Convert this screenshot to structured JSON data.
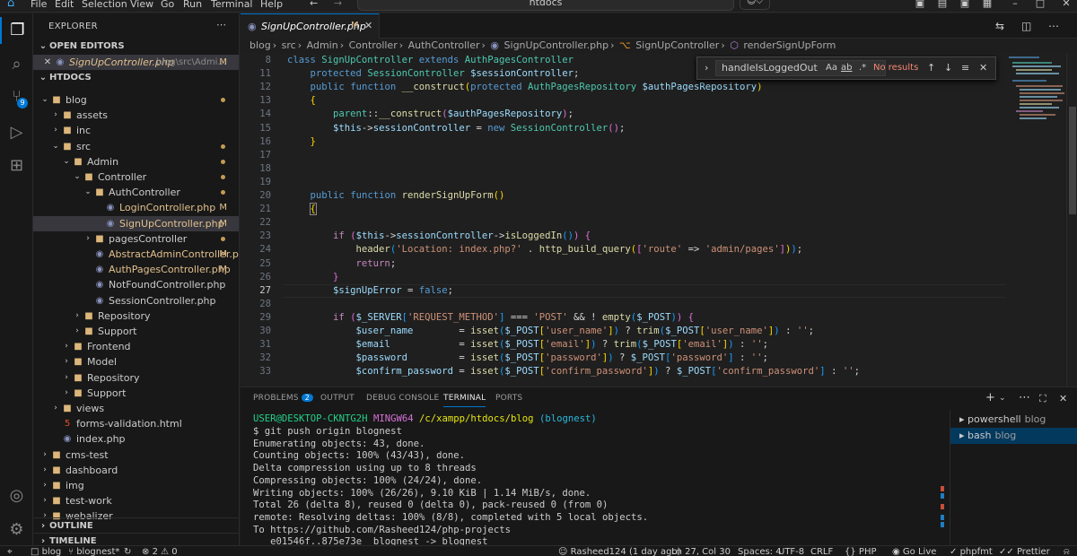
{
  "titlebar": {
    "menu": [
      "File",
      "Edit",
      "Selection",
      "View",
      "Go",
      "Run",
      "Terminal",
      "Help"
    ],
    "search_text": "htdocs"
  },
  "sidebar": {
    "title": "EXPLORER",
    "open_editors_label": "OPEN EDITORS",
    "open_editor": {
      "name": "SignUpController.php",
      "path": "blog\\src\\Admi...",
      "status": "M"
    },
    "root_label": "HTDOCS",
    "tree": [
      {
        "label": "blog",
        "depth": 1,
        "type": "folder",
        "open": true,
        "dot": true
      },
      {
        "label": "assets",
        "depth": 2,
        "type": "folder",
        "open": false
      },
      {
        "label": "inc",
        "depth": 2,
        "type": "folder",
        "open": false
      },
      {
        "label": "src",
        "depth": 2,
        "type": "folder",
        "open": true,
        "dot": true
      },
      {
        "label": "Admin",
        "depth": 3,
        "type": "folder",
        "open": true,
        "dot": true
      },
      {
        "label": "Controller",
        "depth": 4,
        "type": "folder",
        "open": true,
        "dot": true
      },
      {
        "label": "AuthController",
        "depth": 5,
        "type": "folder",
        "open": true,
        "dot": true
      },
      {
        "label": "LoginController.php",
        "depth": 6,
        "type": "php",
        "status": "M"
      },
      {
        "label": "SignUpController.php",
        "depth": 6,
        "type": "php",
        "status": "M",
        "selected": true
      },
      {
        "label": "pagesController",
        "depth": 5,
        "type": "folder",
        "open": false,
        "dot": true
      },
      {
        "label": "AbstractAdminController.php",
        "depth": 5,
        "type": "php",
        "status": "M"
      },
      {
        "label": "AuthPagesController.php",
        "depth": 5,
        "type": "php",
        "status": "M"
      },
      {
        "label": "NotFoundController.php",
        "depth": 5,
        "type": "php"
      },
      {
        "label": "SessionController.php",
        "depth": 5,
        "type": "php"
      },
      {
        "label": "Repository",
        "depth": 4,
        "type": "folder",
        "open": false
      },
      {
        "label": "Support",
        "depth": 4,
        "type": "folder",
        "open": false
      },
      {
        "label": "Frontend",
        "depth": 3,
        "type": "folder",
        "open": false
      },
      {
        "label": "Model",
        "depth": 3,
        "type": "folder",
        "open": false
      },
      {
        "label": "Repository",
        "depth": 3,
        "type": "folder",
        "open": false
      },
      {
        "label": "Support",
        "depth": 3,
        "type": "folder",
        "open": false
      },
      {
        "label": "views",
        "depth": 2,
        "type": "folder",
        "open": false
      },
      {
        "label": "forms-validation.html",
        "depth": 2,
        "type": "html"
      },
      {
        "label": "index.php",
        "depth": 2,
        "type": "php"
      },
      {
        "label": "cms-test",
        "depth": 1,
        "type": "folder",
        "open": false
      },
      {
        "label": "dashboard",
        "depth": 1,
        "type": "folder",
        "open": false
      },
      {
        "label": "img",
        "depth": 1,
        "type": "folder",
        "open": false
      },
      {
        "label": "test-work",
        "depth": 1,
        "type": "folder",
        "open": false
      },
      {
        "label": "webalizer",
        "depth": 1,
        "type": "folder",
        "open": false
      }
    ],
    "outline_label": "OUTLINE",
    "timeline_label": "TIMELINE"
  },
  "editor": {
    "tab": {
      "label": "SignUpController.php",
      "status": "M"
    },
    "breadcrumb": [
      "blog",
      "src",
      "Admin",
      "Controller",
      "AuthController",
      "SignUpController.php",
      "SignUpController",
      "renderSignUpForm"
    ],
    "find": {
      "query": "handleIsLoggedOut",
      "result": "No results"
    },
    "lines": [
      {
        "n": "8",
        "html": "<span class='kw'>class</span> <span class='cls'>SignUpController</span> <span class='kw'>extends</span> <span class='cls'>AuthPagesController</span>"
      },
      {
        "n": "11",
        "html": "    <span class='kw'>protected</span> <span class='cls'>SessionController</span> <span class='var'>$sessionController</span>;"
      },
      {
        "n": "12",
        "html": "    <span class='kw'>public</span> <span class='kw'>function</span> <span class='fn'>__construct</span><span class='br1'>(</span><span class='kw'>protected</span> <span class='cls'>AuthPagesRepository</span> <span class='var'>$authPagesRepository</span><span class='br1'>)</span>"
      },
      {
        "n": "13",
        "html": "    <span class='br1'>{</span>"
      },
      {
        "n": "14",
        "html": "        <span class='cls'>parent</span>::<span class='fn'>__construct</span><span class='br2'>(</span><span class='var'>$authPagesRepository</span><span class='br2'>)</span>;"
      },
      {
        "n": "15",
        "html": "        <span class='var'>$this</span>-&gt;<span class='var'>sessionController</span> = <span class='kw'>new</span> <span class='cls'>SessionController</span><span class='br2'>()</span>;"
      },
      {
        "n": "16",
        "html": "    <span class='br1'>}</span>"
      },
      {
        "n": "17",
        "html": ""
      },
      {
        "n": "18",
        "html": ""
      },
      {
        "n": "19",
        "html": ""
      },
      {
        "n": "20",
        "html": "    <span class='kw'>public</span> <span class='kw'>function</span> <span class='fn'>renderSignUpForm</span><span class='br1'>()</span>"
      },
      {
        "n": "21",
        "html": "    <span class='br1' style='outline:1px solid #888'>{</span>"
      },
      {
        "n": "22",
        "html": ""
      },
      {
        "n": "23",
        "html": "        <span class='kw2'>if</span> <span class='br2'>(</span><span class='var'>$this</span>-&gt;<span class='var'>sessionController</span>-&gt;<span class='fn'>isLoggedIn</span><span class='br3'>()</span><span class='br2'>)</span> <span class='br2'>{</span>"
      },
      {
        "n": "24",
        "html": "            <span class='fn'>header</span><span class='br3'>(</span><span class='str'>'Location: index.php?'</span> . <span class='fn'>http_build_query</span><span class='br1'>(</span><span class='br2'>[</span><span class='str'>'route'</span> =&gt; <span class='str'>'admin/pages'</span><span class='br2'>]</span><span class='br1'>)</span><span class='br3'>)</span>;"
      },
      {
        "n": "25",
        "html": "            <span class='kw2'>return</span>;"
      },
      {
        "n": "26",
        "html": "        <span class='br2'>}</span>"
      },
      {
        "n": "27",
        "html": "        <span class='var'>$signUpError</span> = <span class='kw'>false</span>;"
      },
      {
        "n": "28",
        "html": ""
      },
      {
        "n": "29",
        "html": "        <span class='kw2'>if</span> <span class='br2'>(</span><span class='var'>$_SERVER</span><span class='br3'>[</span><span class='str'>'REQUEST_METHOD'</span><span class='br3'>]</span> === <span class='str'>'POST'</span> &amp;&amp; ! <span class='fn'>empty</span><span class='br3'>(</span><span class='var'>$_POST</span><span class='br3'>)</span><span class='br2'>)</span> <span class='br2'>{</span>"
      },
      {
        "n": "30",
        "html": "            <span class='var'>$user_name</span>        = <span class='fn'>isset</span><span class='br3'>(</span><span class='var'>$_POST</span><span class='br1'>[</span><span class='str'>'user_name'</span><span class='br1'>]</span><span class='br3'>)</span> ? <span class='fn'>trim</span><span class='br3'>(</span><span class='var'>$_POST</span><span class='br1'>[</span><span class='str'>'user_name'</span><span class='br1'>]</span><span class='br3'>)</span> : <span class='str'>''</span>;"
      },
      {
        "n": "31",
        "html": "            <span class='var'>$email</span>            = <span class='fn'>isset</span><span class='br3'>(</span><span class='var'>$_POST</span><span class='br1'>[</span><span class='str'>'email'</span><span class='br1'>]</span><span class='br3'>)</span> ? <span class='fn'>trim</span><span class='br3'>(</span><span class='var'>$_POST</span><span class='br1'>[</span><span class='str'>'email'</span><span class='br1'>]</span><span class='br3'>)</span> : <span class='str'>''</span>;"
      },
      {
        "n": "32",
        "html": "            <span class='var'>$password</span>         = <span class='fn'>isset</span><span class='br3'>(</span><span class='var'>$_POST</span><span class='br1'>[</span><span class='str'>'password'</span><span class='br1'>]</span><span class='br3'>)</span> ? <span class='var'>$_POST</span><span class='br3'>[</span><span class='str'>'password'</span><span class='br3'>]</span> : <span class='str'>''</span>;"
      },
      {
        "n": "33",
        "html": "            <span class='var'>$confirm_password</span> = <span class='fn'>isset</span><span class='br3'>(</span><span class='var'>$_POST</span><span class='br1'>[</span><span class='str'>'confirm_password'</span><span class='br1'>]</span><span class='br3'>)</span> ? <span class='var'>$_POST</span><span class='br3'>[</span><span class='str'>'confirm_password'</span><span class='br3'>]</span> : <span class='str'>''</span>;"
      }
    ],
    "current_line": "27"
  },
  "panel": {
    "tabs": [
      "PROBLEMS",
      "OUTPUT",
      "DEBUG CONSOLE",
      "TERMINAL",
      "PORTS"
    ],
    "problems_count": "2",
    "active_tab": "TERMINAL",
    "terminal": {
      "prompt_user": "USER@DESKTOP-CKNTG2H",
      "prompt_shell": "MINGW64",
      "prompt_path": "/c/xampp/htdocs/blog",
      "prompt_branch": "(blognest)",
      "lines": [
        "$ git push origin blognest",
        "Enumerating objects: 43, done.",
        "Counting objects: 100% (43/43), done.",
        "Delta compression using up to 8 threads",
        "Compressing objects: 100% (24/24), done.",
        "Writing objects: 100% (26/26), 9.10 KiB | 1.14 MiB/s, done.",
        "Total 26 (delta 8), reused 0 (delta 0), pack-reused 0 (from 0)",
        "remote: Resolving deltas: 100% (8/8), completed with 5 local objects.",
        "To https://github.com/Rasheed124/php-projects",
        "   e01546f..875e73e  blognest -> blognest"
      ]
    },
    "terminals": [
      {
        "name": "powershell",
        "folder": "blog"
      },
      {
        "name": "bash",
        "folder": "blog"
      }
    ]
  },
  "statusbar": {
    "folder": "blog",
    "branch": "blognest*",
    "errors": "2",
    "warnings": "0",
    "author": "Rasheed124 (1 day ago)",
    "position": "Ln 27, Col 30",
    "spaces": "Spaces: 4",
    "encoding": "UTF-8",
    "eol": "CRLF",
    "language": "PHP",
    "golive": "Go Live",
    "formatter": "phpfmt",
    "prettier": "Prettier"
  },
  "colors": {
    "accent": "#0078d4",
    "modified": "#e2c08d",
    "error_text": "#f48771"
  }
}
